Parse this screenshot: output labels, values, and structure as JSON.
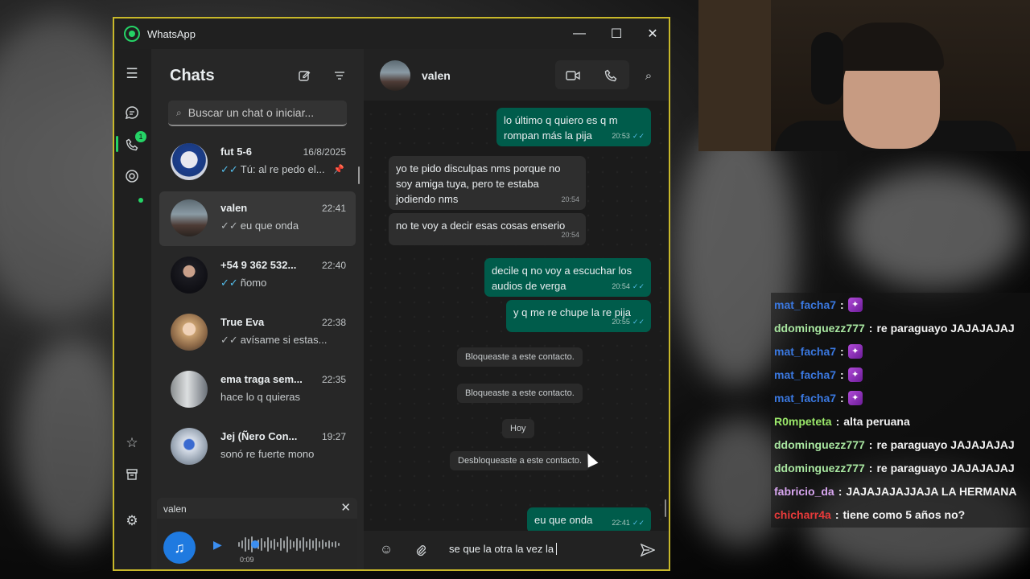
{
  "window": {
    "app_title": "WhatsApp",
    "controls": {
      "minimize": "—",
      "maximize": "☐",
      "close": "✕"
    }
  },
  "rail": {
    "unread_badge": "1",
    "icons": [
      "menu-icon",
      "chats-icon",
      "calls-icon",
      "status-icon",
      "starred-icon",
      "archive-icon",
      "settings-icon"
    ]
  },
  "chat_list": {
    "title": "Chats",
    "search_placeholder": "Buscar un chat o iniciar...",
    "chats": [
      {
        "name": "fut 5-6",
        "time": "16/8/2025",
        "tick": "✓✓",
        "preview": "Tú: al re pedo el...",
        "pinned": true
      },
      {
        "name": "valen",
        "time": "22:41",
        "tick": "✓✓",
        "preview": "eu que onda",
        "active": true
      },
      {
        "name": "+54 9 362 532...",
        "time": "22:40",
        "tick": "✓✓",
        "preview": "ñomo"
      },
      {
        "name": "True Eva",
        "time": "22:38",
        "tick": "✓✓",
        "preview": "avísame si estas..."
      },
      {
        "name": "ema traga sem...",
        "time": "22:35",
        "tick": "",
        "preview": "hace lo q quieras"
      },
      {
        "name": "Jej (Ñero Con...",
        "time": "19:27",
        "tick": "",
        "preview": "sonó re fuerte mono"
      }
    ],
    "player": {
      "name": "valen",
      "time": "0:09",
      "close": "✕"
    }
  },
  "conversation": {
    "contact_name": "valen",
    "messages": [
      {
        "dir": "out",
        "text": "lo último q quiero es q m rompan más la pija",
        "time": "20:53",
        "ticks": "✓✓"
      },
      {
        "dir": "in",
        "text": "yo te pido disculpas nms porque no soy amiga tuya,  pero te estaba jodiendo nms",
        "time": "20:54"
      },
      {
        "dir": "in",
        "text": "no te voy a decir esas cosas enserio",
        "time": "20:54"
      },
      {
        "dir": "out",
        "text": "decile q no voy a escuchar los audios de verga",
        "time": "20:54",
        "ticks": "✓✓"
      },
      {
        "dir": "out",
        "text": "y q me re chupe la re pija",
        "time": "20:55",
        "ticks": "✓✓"
      },
      {
        "dir": "sys",
        "text": "Bloqueaste a este contacto."
      },
      {
        "dir": "sys",
        "text": "Bloqueaste a este contacto."
      },
      {
        "dir": "sys",
        "text": "Hoy"
      },
      {
        "dir": "sys",
        "text": "Desbloqueaste a este contacto."
      },
      {
        "dir": "out",
        "text": "eu que onda",
        "time": "22:41",
        "ticks": "✓✓"
      }
    ],
    "compose_text": "se que la otra la vez la"
  },
  "stream_chat": [
    {
      "user": "mat_facha7",
      "color": "#3a78e0",
      "message": "",
      "emote": true
    },
    {
      "user": "ddominguezz777",
      "color": "#a8e6a0",
      "message": "re paraguayo JAJAJAJAJ"
    },
    {
      "user": "mat_facha7",
      "color": "#3a78e0",
      "message": "",
      "emote": true
    },
    {
      "user": "mat_facha7",
      "color": "#3a78e0",
      "message": "",
      "emote": true
    },
    {
      "user": "mat_facha7",
      "color": "#3a78e0",
      "message": "",
      "emote": true
    },
    {
      "user": "R0mpeteta",
      "color": "#9be86a",
      "message": "alta peruana"
    },
    {
      "user": "ddominguezz777",
      "color": "#a8e6a0",
      "message": "re paraguayo JAJAJAJAJ"
    },
    {
      "user": "ddominguezz777",
      "color": "#a8e6a0",
      "message": "re paraguayo JAJAJAJAJ"
    },
    {
      "user": "fabricio_da",
      "color": "#d8a6f0",
      "message": "JAJAJAJAJJAJA LA HERMANA"
    },
    {
      "user": "chicharr4a",
      "color": "#e83a3a",
      "message": "tiene como 5 años no?"
    }
  ]
}
